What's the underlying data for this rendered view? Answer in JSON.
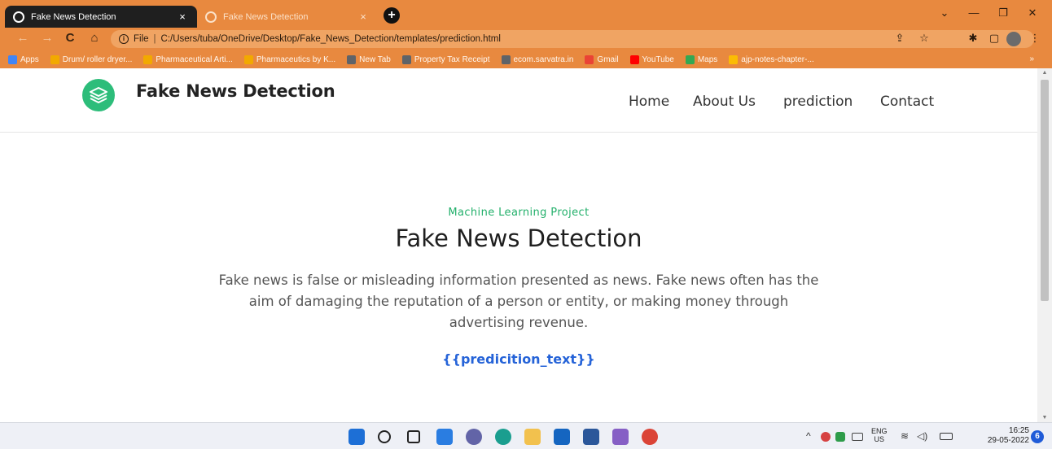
{
  "browser": {
    "tabs": [
      {
        "title": "Fake News Detection",
        "close": "×"
      },
      {
        "title": "Fake News Detection",
        "close": "×"
      }
    ],
    "new_tab": "+",
    "window": {
      "chevron": "⌄",
      "minimize": "—",
      "restore": "❐",
      "close": "✕"
    },
    "nav": {
      "back": "←",
      "forward": "→",
      "reload": "C",
      "home": "⌂"
    },
    "address": {
      "scheme_label": "File",
      "url": "C:/Users/tuba/OneDrive/Desktop/Fake_News_Detection/templates/prediction.html"
    },
    "omnibox_icons": {
      "share": "⇪",
      "star": "☆",
      "extensions": "✱",
      "sidepanel": "▢",
      "menu": "⋮"
    },
    "bookmarks": [
      {
        "label": "Apps",
        "color": "#4285f4"
      },
      {
        "label": "Drum/ roller dryer...",
        "color": "#f2a900"
      },
      {
        "label": "Pharmaceutical Arti...",
        "color": "#f2a900"
      },
      {
        "label": "Pharmaceutics by K...",
        "color": "#f2a900"
      },
      {
        "label": "New Tab",
        "color": "#5f6368"
      },
      {
        "label": "Property Tax Receipt",
        "color": "#5f6368"
      },
      {
        "label": "ecom.sarvatra.in",
        "color": "#5f6368"
      },
      {
        "label": "Gmail",
        "color": "#ea4335"
      },
      {
        "label": "YouTube",
        "color": "#ff0000"
      },
      {
        "label": "Maps",
        "color": "#34a853"
      },
      {
        "label": "ajp-notes-chapter-...",
        "color": "#fbbc04"
      }
    ],
    "bookmarks_more": "»"
  },
  "site": {
    "brand": "Fake News Detection",
    "nav": [
      "Home",
      "About Us",
      "prediction",
      "Contact"
    ]
  },
  "hero": {
    "subtitle": "Machine Learning Project",
    "title": "Fake News Detection",
    "description": "Fake news is false or misleading information presented as news. Fake news often has the aim of damaging the reputation of a person or entity, or making money through advertising revenue.",
    "prediction_text": "{{predicition_text}}"
  },
  "taskbar": {
    "apps": [
      {
        "name": "start",
        "color": "#1d6fd6"
      },
      {
        "name": "search",
        "color": "#222222"
      },
      {
        "name": "task-view",
        "color": "#222222"
      },
      {
        "name": "widgets",
        "color": "#2a7de1"
      },
      {
        "name": "chat",
        "color": "#6264a7"
      },
      {
        "name": "edge",
        "color": "#1a9e8f"
      },
      {
        "name": "file-explorer",
        "color": "#f2c14e"
      },
      {
        "name": "mail",
        "color": "#1565c0"
      },
      {
        "name": "word",
        "color": "#2b579a"
      },
      {
        "name": "visual-studio",
        "color": "#865fc5"
      },
      {
        "name": "chrome",
        "color": "#db4437"
      }
    ],
    "tray": {
      "lang_top": "ENG",
      "lang_bottom": "US",
      "time": "16:25",
      "date": "29-05-2022",
      "notifications": "6"
    }
  },
  "colors": {
    "chrome": "#e8893f",
    "accent_green": "#23b06b",
    "prediction_blue": "#2563d8"
  }
}
